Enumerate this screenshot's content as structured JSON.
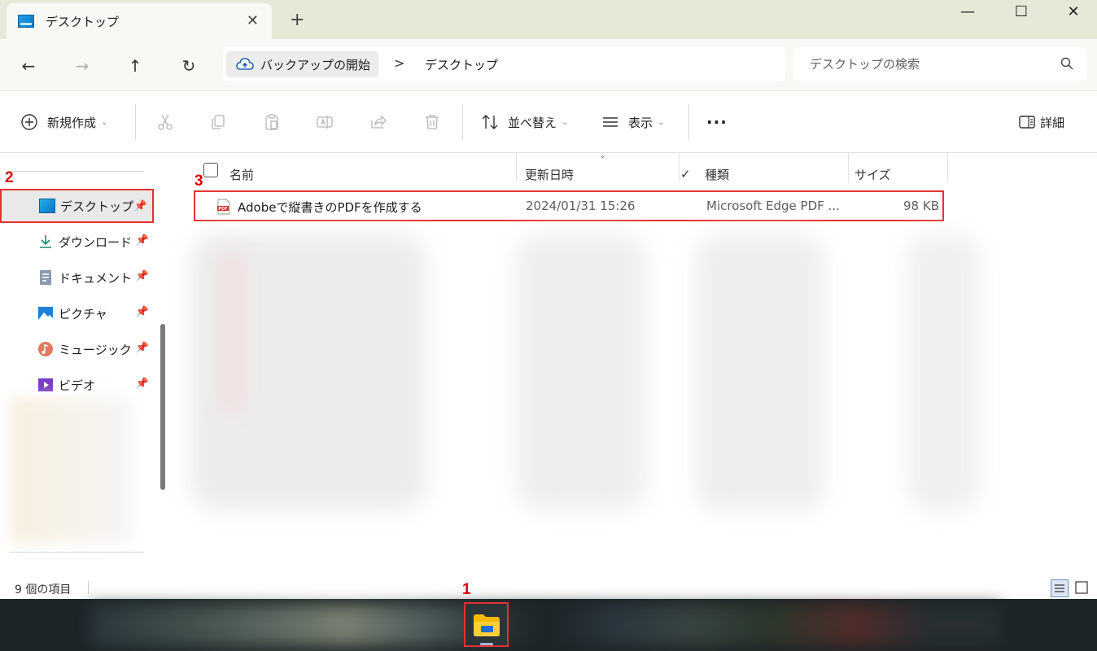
{
  "window": {
    "tab_title": "デスクトップ",
    "new_tab": "+",
    "minimize": "—",
    "maximize": "☐",
    "close": "✕",
    "tab_close": "✕"
  },
  "nav": {
    "back": "←",
    "forward": "→",
    "up": "↑",
    "refresh": "↻",
    "backup_label": "バックアップの開始",
    "separator": ">",
    "current_folder": "デスクトップ",
    "search_placeholder": "デスクトップの検索"
  },
  "commands": {
    "new_label": "新規作成",
    "sort_label": "並べ替え",
    "view_label": "表示",
    "more_label": "···",
    "details_label": "詳細",
    "chevron": "⌄"
  },
  "sidebar": {
    "items": [
      {
        "label": "デスクトップ",
        "icon": "desktop-icon"
      },
      {
        "label": "ダウンロード",
        "icon": "download-icon"
      },
      {
        "label": "ドキュメント",
        "icon": "document-icon"
      },
      {
        "label": "ピクチャ",
        "icon": "pictures-icon"
      },
      {
        "label": "ミュージック",
        "icon": "music-icon"
      },
      {
        "label": "ビデオ",
        "icon": "video-icon"
      }
    ],
    "pin_glyph": "📌"
  },
  "columns": {
    "name": "名前",
    "date": "更新日時",
    "type": "種類",
    "size": "サイズ",
    "sort_chevron": "⌄",
    "check": "✓"
  },
  "file": {
    "name": "Adobeで縦書きのPDFを作成する",
    "date": "2024/01/31 15:26",
    "type": "Microsoft Edge PDF ...",
    "size": "98 KB"
  },
  "status": {
    "item_count": "9 個の項目"
  },
  "steps": {
    "s1": "1",
    "s2": "2",
    "s3": "3"
  },
  "colors": {
    "highlight": "#e33232",
    "titlebar": "#e7e9d8",
    "taskbar": "#1d2426"
  }
}
